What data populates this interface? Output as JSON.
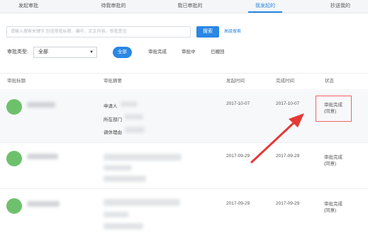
{
  "tabs": [
    {
      "label": "发起审批"
    },
    {
      "label": "待我审批的"
    },
    {
      "label": "我已审批的"
    },
    {
      "label": "我发起的"
    },
    {
      "label": "抄送我的"
    }
  ],
  "search": {
    "placeholder": "请输入搜索关键字,包括审批标题、编号、正文内容、审批意见",
    "button_label": "搜索",
    "advanced_label": "高级搜索"
  },
  "filter": {
    "type_label": "审批类型:",
    "type_value": "全部",
    "status_chips": [
      "全部",
      "审批完成",
      "审批中",
      "已撤回"
    ]
  },
  "table": {
    "headers": [
      "审批标题",
      "审批摘要",
      "发起时间",
      "完成时间",
      "状态"
    ],
    "rows": [
      {
        "summary_labels": [
          "申请人",
          "所在部门",
          "调休理由"
        ],
        "start_time": "2017-10-07",
        "end_time": "2017-10-07",
        "status": [
          "审批完成",
          "(同意)"
        ]
      },
      {
        "start_time": "2017-09-29",
        "end_time": "2017-09-29",
        "status": [
          "审批完成",
          "(同意)"
        ]
      },
      {
        "start_time": "2017-09-29",
        "end_time": "2017-09-29",
        "status": [
          "审批完成",
          "(同意)"
        ]
      }
    ]
  },
  "colors": {
    "accent": "#2a87e4",
    "avatar": "#6ec16c",
    "annotation": "#e53935"
  }
}
